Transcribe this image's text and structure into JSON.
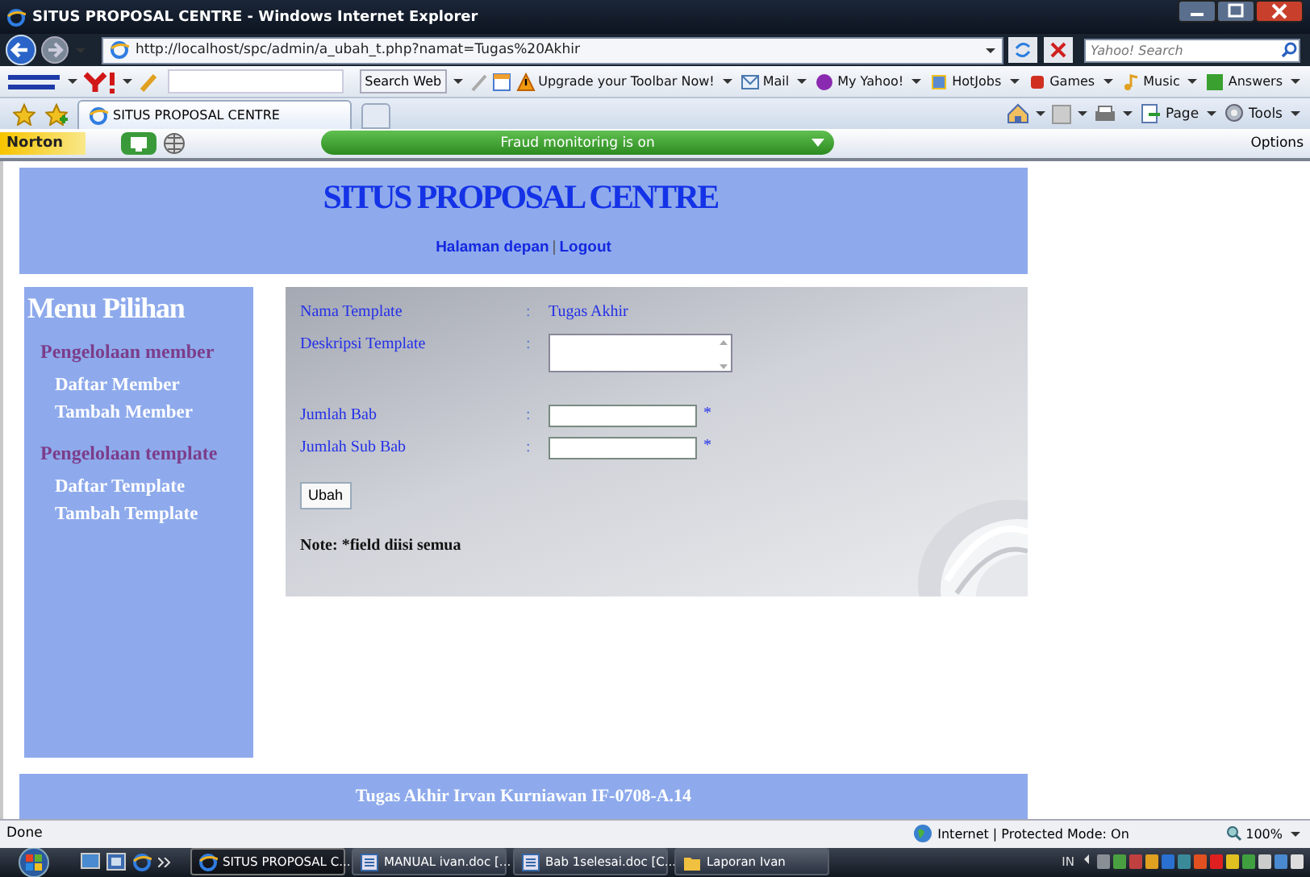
{
  "window": {
    "title": "SITUS PROPOSAL CENTRE - Windows Internet Explorer"
  },
  "address_bar": {
    "url": "http://localhost/spc/admin/a_ubah_t.php?namat=Tugas%20Akhir",
    "search_placeholder": "Yahoo! Search"
  },
  "yahoo_toolbar": {
    "search_button": "Search Web",
    "items": [
      {
        "label": "Upgrade your Toolbar Now!"
      },
      {
        "label": "Mail"
      },
      {
        "label": "My Yahoo!"
      },
      {
        "label": "HotJobs"
      },
      {
        "label": "Games"
      },
      {
        "label": "Music"
      },
      {
        "label": "Answers"
      }
    ]
  },
  "tabs": [
    {
      "label": "SITUS PROPOSAL CENTRE",
      "selected": true
    }
  ],
  "command_bar": [
    "Page",
    "Tools"
  ],
  "norton_bar": {
    "brand": "Norton",
    "status": "Fraud monitoring is on",
    "options": "Options"
  },
  "page": {
    "header": {
      "title": "SITUS PROPOSAL CENTRE",
      "links": [
        "Halaman depan",
        "Logout"
      ],
      "separator": "|"
    },
    "sidebar": {
      "title": "Menu Pilihan",
      "groups": [
        {
          "heading": "Pengelolaan member",
          "items": [
            "Daftar Member",
            "Tambah Member"
          ]
        },
        {
          "heading": "Pengelolaan template",
          "items": [
            "Daftar Template",
            "Tambah Template"
          ]
        }
      ]
    },
    "form": {
      "rows": [
        {
          "label": "Nama Template",
          "separator": ":",
          "kind": "text",
          "value": "Tugas Akhir"
        },
        {
          "label": "Deskripsi Template",
          "separator": ":",
          "kind": "textarea"
        },
        {
          "label": "Jumlah Bab",
          "separator": ":",
          "kind": "input",
          "required": "*"
        },
        {
          "label": "Jumlah Sub Bab",
          "separator": ":",
          "kind": "input",
          "required": "*"
        }
      ],
      "button": "Ubah",
      "note": "Note: *field diisi semua"
    },
    "footer": "Tugas Akhir Irvan Kurniawan IF-0708-A.14"
  },
  "status_bar": {
    "text": "Done",
    "zone": "Internet | Protected Mode: On",
    "zoom": "100%"
  },
  "taskbar": {
    "items": [
      {
        "label": "SITUS PROPOSAL C...",
        "selected": true
      },
      {
        "label": "MANUAL ivan.doc [...",
        "selected": false
      },
      {
        "label": "Bab 1selesai.doc [C...",
        "selected": false
      },
      {
        "label": "Laporan Ivan",
        "selected": false
      }
    ],
    "language": "IN"
  }
}
